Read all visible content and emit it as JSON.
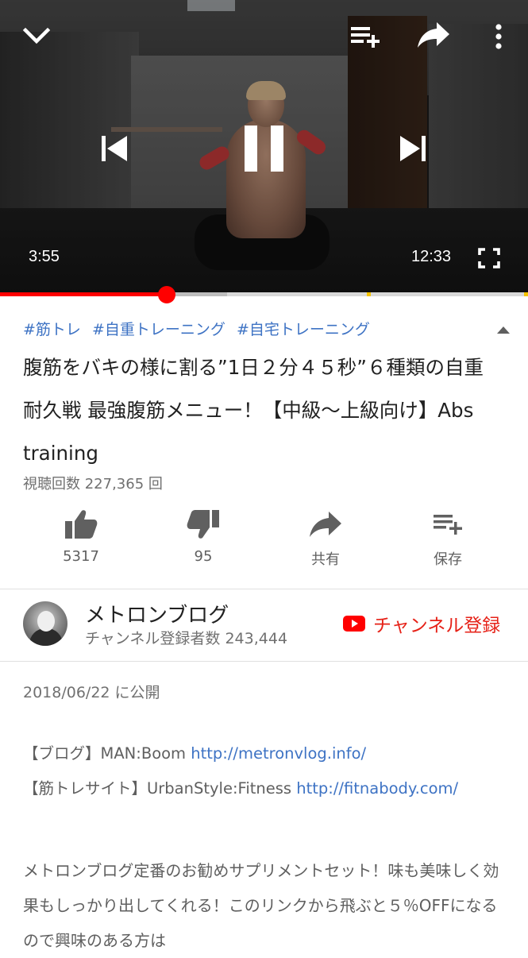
{
  "player": {
    "current_time": "3:55",
    "total_time": "12:33",
    "progress_fraction": 0.316,
    "buffered_fraction": 0.43,
    "ad_markers_fraction": [
      0.695,
      0.995
    ],
    "colors": {
      "played": "#ff0000",
      "marker": "#f5c400"
    },
    "icons": {
      "minimize": "chevron-down-icon",
      "add_to_playlist": "playlist-add-icon",
      "share": "share-icon",
      "more": "more-vert-icon",
      "previous": "skip-previous-icon",
      "pause": "pause-icon",
      "next": "skip-next-icon",
      "fullscreen": "fullscreen-icon"
    }
  },
  "video": {
    "hashtags": [
      "#筋トレ",
      "#自重トレーニング",
      "#自宅トレーニング"
    ],
    "title": "腹筋をバキの様に割る”1日２分４５秒”６種類の自重耐久戦 最強腹筋メニュー！【中級〜上級向け】Abs training",
    "views": "視聴回数 227,365 回"
  },
  "actions": {
    "like_count": "5317",
    "dislike_count": "95",
    "share_label": "共有",
    "save_label": "保存"
  },
  "channel": {
    "name": "メトロンブログ",
    "subscribers": "チャンネル登録者数 243,444",
    "subscribe_label": "チャンネル登録",
    "accent_color": "#e62117"
  },
  "description": {
    "published": "2018/06/22 に公開",
    "line1_prefix": "【ブログ】MAN:Boom ",
    "line1_link": "http://metronvlog.info/",
    "line2_prefix": "【筋トレサイト】UrbanStyle:Fitness ",
    "line2_link": "http://fitnabody.com/",
    "paragraph": "メトロンブログ定番のお勧めサプリメントセット！味も美味しく効果もしっかり出してくれる！このリンクから飛ぶと５％OFFになるので興味のある方は"
  }
}
